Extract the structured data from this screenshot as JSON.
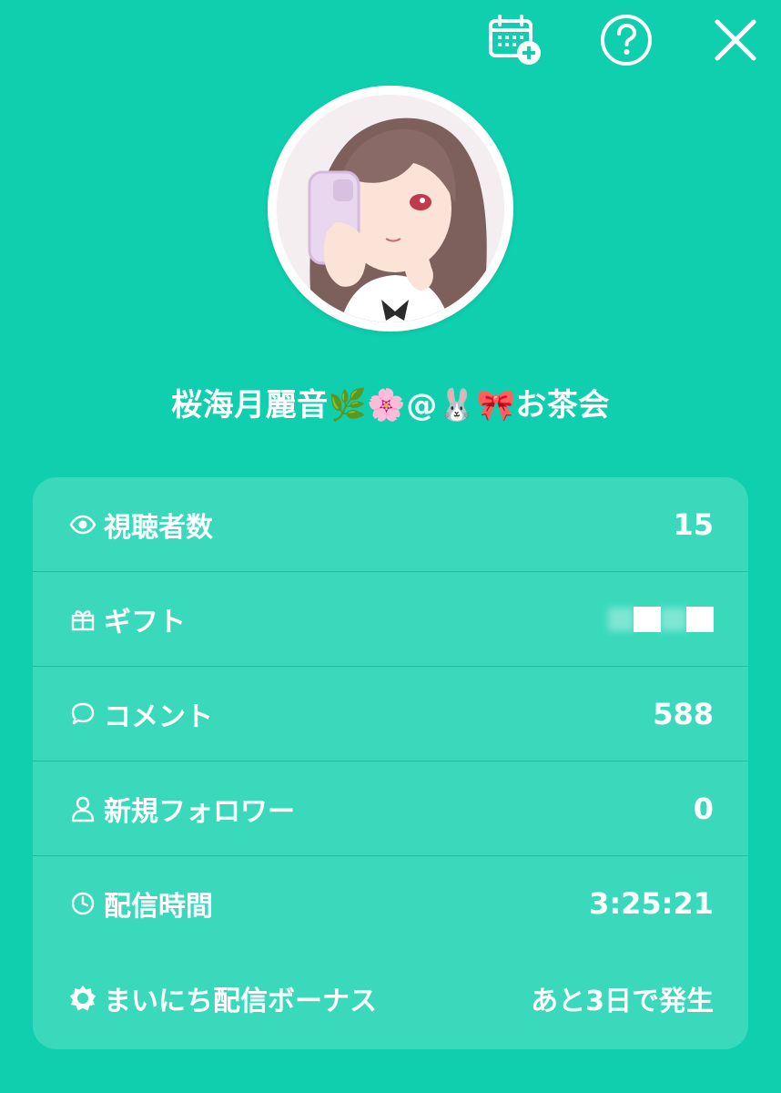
{
  "topbar": {
    "calendar_icon": "calendar-add-icon",
    "help_icon": "help-circle-icon",
    "close_icon": "close-icon"
  },
  "profile": {
    "display_name": "桜海月麗音🌿🌸@🐰🎀お茶会",
    "avatar": "anime-girl-avatar"
  },
  "stats": [
    {
      "icon": "eye-icon",
      "label": "視聴者数",
      "value": "15"
    },
    {
      "icon": "gift-icon",
      "label": "ギフト",
      "value": ""
    },
    {
      "icon": "comment-icon",
      "label": "コメント",
      "value": "588"
    },
    {
      "icon": "person-icon",
      "label": "新規フォロワー",
      "value": "0"
    },
    {
      "icon": "clock-icon",
      "label": "配信時間",
      "value": "3:25:21"
    },
    {
      "icon": "sun-badge-icon",
      "label": "まいにち配信ボーナス",
      "value": "あと3日で発生"
    }
  ],
  "colors": {
    "background": "#0fcfae",
    "card": "#3ad9bc",
    "text": "#ffffff"
  }
}
